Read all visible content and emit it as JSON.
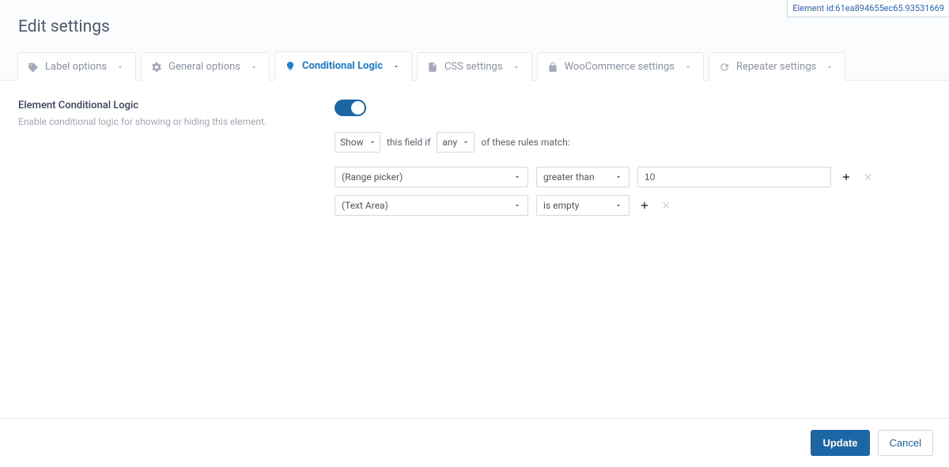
{
  "element_id_label": "Element id:61ea894655ec65.93531669",
  "header": {
    "title": "Edit settings"
  },
  "tabs": [
    {
      "label": "Label options",
      "active": false
    },
    {
      "label": "General options",
      "active": false
    },
    {
      "label": "Conditional Logic",
      "active": true
    },
    {
      "label": "CSS settings",
      "active": false
    },
    {
      "label": "WooCommerce settings",
      "active": false
    },
    {
      "label": "Repeater settings",
      "active": false
    }
  ],
  "conditional": {
    "label": "Element Conditional Logic",
    "help": "Enable conditional logic for showing or hiding this element.",
    "enabled": true,
    "action": "Show",
    "match": "any",
    "sentence_mid": "this field if",
    "sentence_end": "of these rules match:",
    "rules": [
      {
        "field": "(Range picker)",
        "condition": "greater than",
        "value": "10"
      },
      {
        "field": "(Text Area)",
        "condition": "is empty",
        "value": null
      }
    ]
  },
  "footer": {
    "update": "Update",
    "cancel": "Cancel"
  }
}
